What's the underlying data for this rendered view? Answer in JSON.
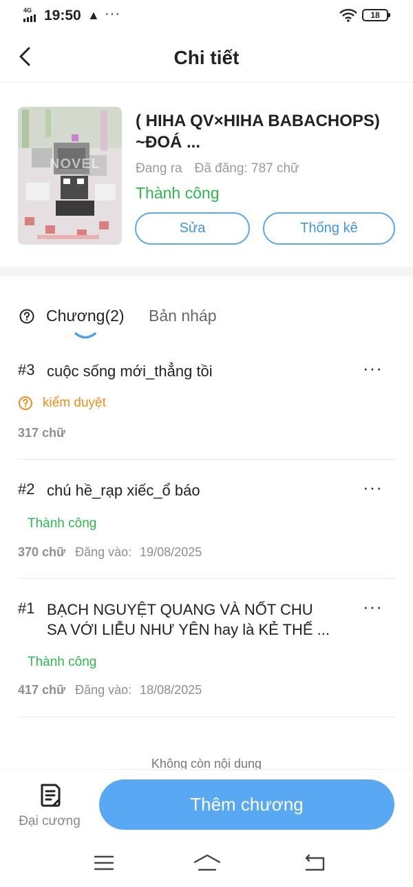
{
  "status_bar": {
    "network": "4G",
    "time": "19:50",
    "warning_icon": "warning-triangle-icon",
    "more": "···",
    "battery": "18"
  },
  "header": {
    "title": "Chi tiết",
    "back_icon": "chevron-left-icon"
  },
  "story": {
    "title": "( HIHA QV×HIHA BABACHOPS) ~ĐOÁ ...",
    "state": "Đang ra",
    "published": "Đã đăng: 787 chữ",
    "status": "Thành công",
    "edit_label": "Sửa",
    "stats_label": "Thống kê",
    "cover_text": "NOVEL"
  },
  "tabs": {
    "chapters": "Chương(2)",
    "drafts": "Bản nháp"
  },
  "chapters": [
    {
      "num": "#3",
      "title": "cuộc sống mới_thẳng tồi",
      "status": "kiểm duyệt",
      "words": "317 chữ",
      "date_label": "",
      "date": ""
    },
    {
      "num": "#2",
      "title": "chú hề_rạp xiếc_ổ báo",
      "status": "Thành công",
      "words": "370 chữ",
      "date_label": "Đăng vào:",
      "date": "19/08/2025"
    },
    {
      "num": "#1",
      "title": "BẠCH NGUYỆT QUANG VÀ NỐT CHU SA VỚI LIỄU NHƯ YÊN hay là KẺ THẾ ...",
      "status": "Thành công",
      "words": "417 chữ",
      "date_label": "Đăng vào:",
      "date": "18/08/2025"
    }
  ],
  "more_label": "···",
  "footer_note": "Không còn nội dung",
  "bottom": {
    "outline_label": "Đại cương",
    "add_chapter_label": "Thêm chương"
  },
  "colors": {
    "accent": "#58a8f4",
    "success": "#2db84d",
    "review": "#f0901a"
  }
}
